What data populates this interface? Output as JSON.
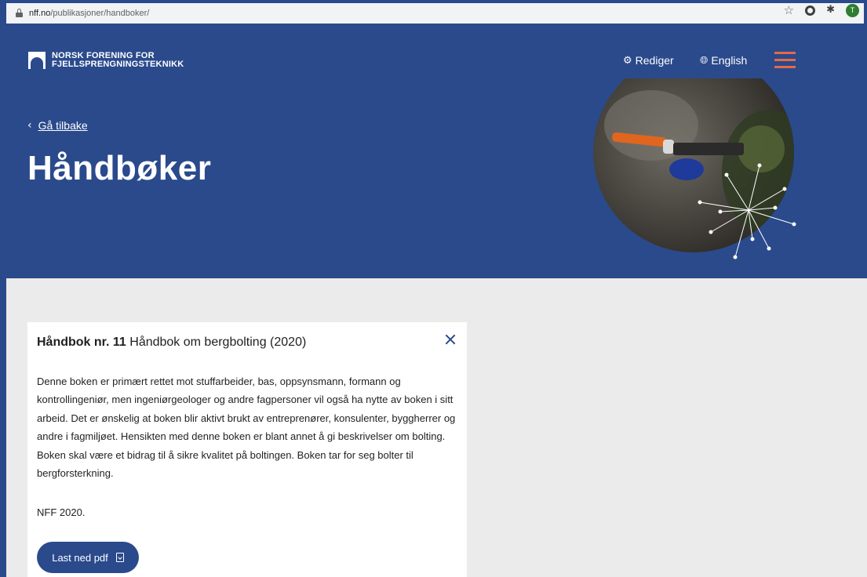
{
  "browser": {
    "url_domain": "nff.no",
    "url_path": "/publikasjoner/handboker/",
    "lock_icon": "lock-icon",
    "bookmark_icon": "star-icon",
    "profile_initial": "T"
  },
  "header": {
    "logo_line1": "NORSK FORENING FOR",
    "logo_line2": "FJELLSPRENGNINGSTEKNIKK",
    "edit_label": "Rediger",
    "edit_icon": "gear-icon",
    "language_label": "English",
    "language_icon": "globe-icon",
    "menu_icon": "hamburger-menu-icon",
    "menu_color": "#e46a48"
  },
  "hero": {
    "back_label": "Gå tilbake",
    "title": "Håndbøker"
  },
  "card": {
    "title_bold": "Håndbok nr. 11",
    "title_rest": " Håndbok om bergbolting (2020)",
    "description": "Denne boken er primært rettet mot stuffarbeider, bas, oppsynsmann, formann og kontrollingeniør, men ingeniørgeologer og andre fagpersoner vil også ha nytte av boken i sitt arbeid. Det er ønskelig at boken blir aktivt brukt av entreprenører, konsulenter, byggherrer og andre i fagmiljøet. Hensikten med denne boken er blant annet å gi beskrivelser om bolting. Boken skal være et bidrag til å sikre kvalitet på boltingen. Boken tar for seg bolter til bergforsterkning.",
    "note": "NFF 2020.",
    "download_label": "Last ned pdf"
  },
  "colors": {
    "brand_blue": "#2a4a8c",
    "accent_orange": "#e46a48",
    "content_bg": "#ebebeb"
  }
}
